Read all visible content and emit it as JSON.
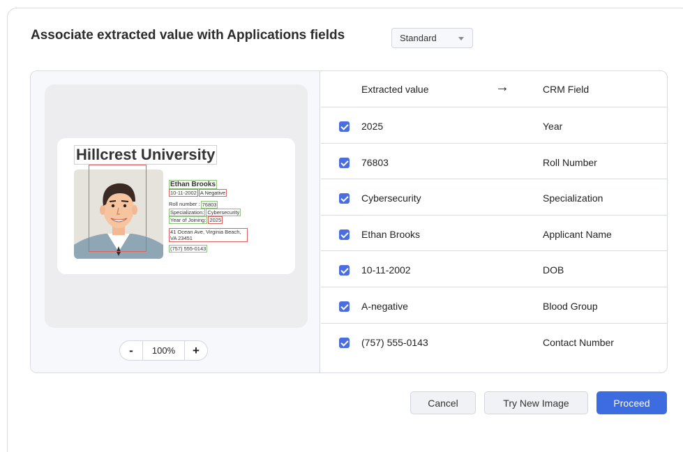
{
  "header": {
    "title": "Associate extracted value with Applications fields",
    "mode_selected": "Standard"
  },
  "card": {
    "university": "Hillcrest University",
    "name": "Ethan Brooks",
    "dob": "10-11-2002",
    "blood": "A Negative",
    "roll_label": "Roll number :",
    "roll_value": "76803",
    "spec_label": "Specialization:",
    "spec_value": "Cybersecurity",
    "year_label": "Year of Joining:",
    "year_value": "2025",
    "address": "41 Ocean Ave, Virginia Beach, VA 23451",
    "phone": "(757) 555-0143"
  },
  "zoom": {
    "minus": "-",
    "value": "100%",
    "plus": "+"
  },
  "table": {
    "col_extracted": "Extracted value",
    "arrow": "→",
    "col_crm": "CRM Field",
    "rows": [
      {
        "value": "2025",
        "field": "Year",
        "checked": true
      },
      {
        "value": "76803",
        "field": "Roll Number",
        "checked": true
      },
      {
        "value": "Cybersecurity",
        "field": "Specialization",
        "checked": true
      },
      {
        "value": "Ethan Brooks",
        "field": "Applicant Name",
        "checked": true
      },
      {
        "value": "10-11-2002",
        "field": "DOB",
        "checked": true
      },
      {
        "value": "A-negative",
        "field": "Blood Group",
        "checked": true
      },
      {
        "value": "(757) 555-0143",
        "field": "Contact Number",
        "checked": true
      }
    ]
  },
  "buttons": {
    "cancel": "Cancel",
    "try_new": "Try New Image",
    "proceed": "Proceed"
  },
  "colors": {
    "accent": "#3d6ce0",
    "checkbox": "#4a6ee0",
    "box_green": "#8bc37a",
    "box_red": "#e06060"
  }
}
